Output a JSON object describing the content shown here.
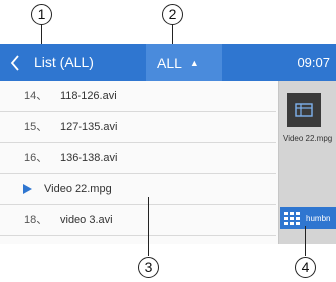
{
  "callouts": [
    "1",
    "2",
    "3",
    "4"
  ],
  "header": {
    "back_icon": "chevron-left-icon",
    "title": "List (ALL)",
    "filter_label": "ALL",
    "filter_icon": "triangle-up-icon",
    "time": "09:07"
  },
  "list": {
    "items": [
      {
        "index": "14、",
        "name": "118-126.avi",
        "playing": false
      },
      {
        "index": "15、",
        "name": "127-135.avi",
        "playing": false
      },
      {
        "index": "16、",
        "name": "136-138.avi",
        "playing": false
      },
      {
        "index": "",
        "name": "Video 22.mpg",
        "playing": true
      },
      {
        "index": "18、",
        "name": "video 3.avi",
        "playing": false
      }
    ]
  },
  "sidebar": {
    "thumb_icon": "video-thumbnail-icon",
    "now_playing": "Video 22.mpg",
    "thumbs_button_icon": "grid-icon",
    "thumbs_button_label": "humbn"
  },
  "colors": {
    "header_bg": "#2f76d0",
    "filter_bg": "#4a8bdc",
    "play_icon": "#2f76d0"
  }
}
